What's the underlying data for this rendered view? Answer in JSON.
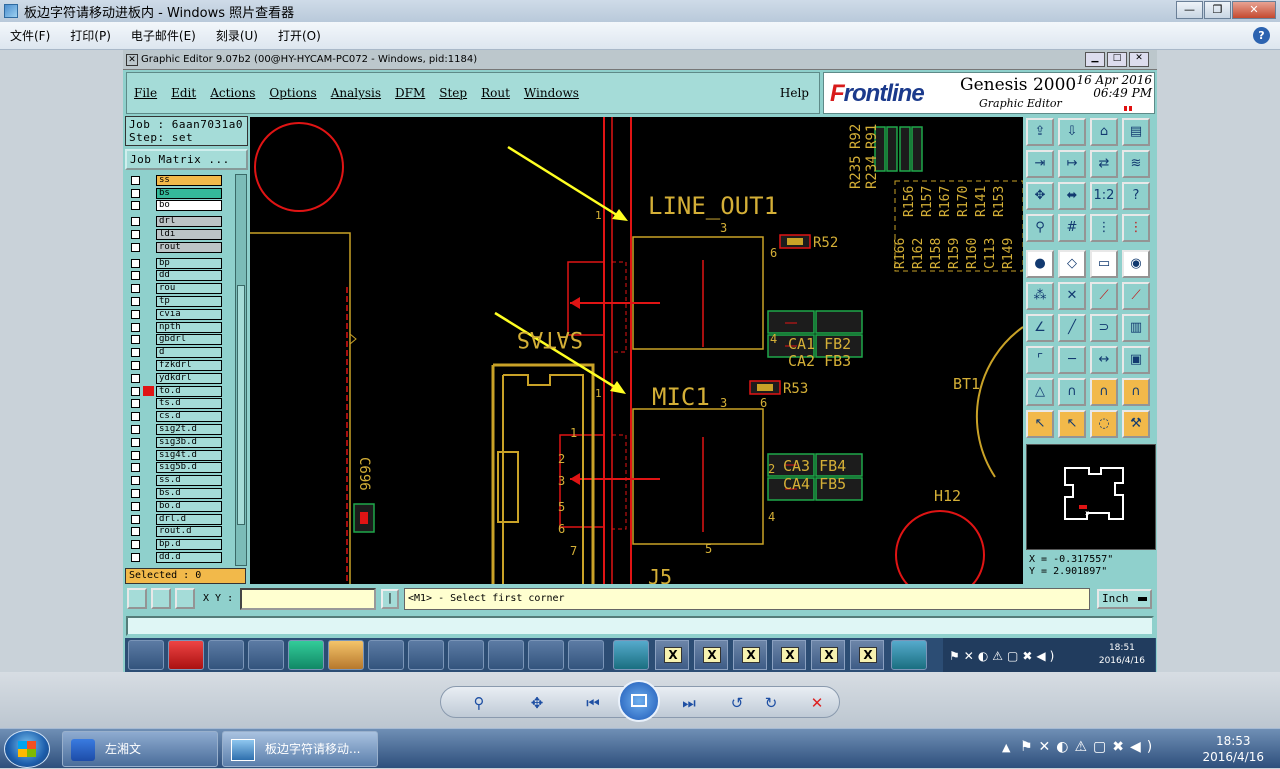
{
  "photo_viewer": {
    "title": "板边字符请移动进板内 - Windows 照片查看器",
    "window_buttons": [
      "—",
      "❐",
      "✕"
    ],
    "menu": [
      "文件(F)",
      "打印(P)",
      "电子邮件(E)",
      "刻录(U)",
      "打开(O)"
    ],
    "help_icon": "?"
  },
  "genesis": {
    "window_title": "Graphic Editor 9.07b2 (00@HY-HYCAM-PC072 - Windows, pid:1184)",
    "menu": [
      "File",
      "Edit",
      "Actions",
      "Options",
      "Analysis",
      "DFM",
      "Step",
      "Rout",
      "Windows"
    ],
    "help": "Help",
    "brand": {
      "logo_prefix": "F",
      "logo_rest": "rontline",
      "product": "Genesis 2000",
      "subtitle": "Graphic Editor",
      "date": "16 Apr 2016",
      "time": "06:49 PM"
    },
    "job": "Job : 6aan7031a0",
    "step": "Step: set",
    "job_matrix": "Job Matrix ...",
    "layers_top": [
      {
        "name": "ss",
        "color": "yellow"
      },
      {
        "name": "bs",
        "color": "green"
      },
      {
        "name": "bo",
        "color": "white"
      }
    ],
    "layers_drill": [
      {
        "name": "drl",
        "color": "grey"
      },
      {
        "name": "ldi",
        "color": "grey"
      },
      {
        "name": "rout",
        "color": "grey"
      }
    ],
    "layers_misc": [
      "bp",
      "dd",
      "rou",
      "tp",
      "cvia",
      "npth",
      "gbdrl",
      "d",
      "fzkdrl",
      "ydkdrl",
      "to.d",
      "ts.d",
      "cs.d",
      "sig2t.d",
      "sig3b.d",
      "sig4t.d",
      "sig5b.d",
      "ss.d",
      "bs.d",
      "bo.d",
      "drl.d",
      "rout.d",
      "bp.d",
      "dd.d"
    ],
    "selected": "Selected : 0",
    "xy_label": "X Y :",
    "xy_value": "",
    "xy_button": "|",
    "prompt": "<M1> - Select first corner",
    "units": "Inch",
    "coord_x": "X = -0.317557\"",
    "coord_y": "Y = 2.901897\"",
    "status": ""
  },
  "canvas": {
    "labels": {
      "line_out": "LINE_OUT1",
      "mic": "MIC1",
      "satas": "SATAS",
      "r52": "R52",
      "r53": "R53",
      "ca1fb2": "CA1 FB2",
      "ca2fb3": "CA2 FB3",
      "ca3fb4": "CA3 FB4",
      "ca4fb5": "CA4 FB5",
      "bt1": "BT1",
      "h12": "H12",
      "c696": "C696",
      "j5": "J5",
      "r235": "R235",
      "r234": "R234",
      "r92": "R92",
      "r91": "R91",
      "rcol": [
        "R166",
        "R156",
        "R162",
        "R157",
        "R158",
        "R167",
        "R159",
        "R170",
        "R160",
        "R141",
        "C113",
        "R153",
        "R149"
      ],
      "pin3": "3",
      "pin6": "6",
      "pin4": "4",
      "pin5": "5",
      "pin2": "2",
      "pin1": "1",
      "pin7": "7"
    }
  },
  "inner_taskbar": {
    "clock_time": "18:51",
    "clock_date": "2016/4/16"
  },
  "viewer_controls": {
    "zoom": "⚲",
    "fit": "✥",
    "prev": "⏮",
    "next": "⏭",
    "rotate_ccw": "↺",
    "rotate_cw": "↻",
    "delete": "✕"
  },
  "win7_taskbar": {
    "tasks": [
      "左湘文",
      "板边字符请移动..."
    ],
    "clock_time": "18:53",
    "clock_date": "2016/4/16"
  }
}
